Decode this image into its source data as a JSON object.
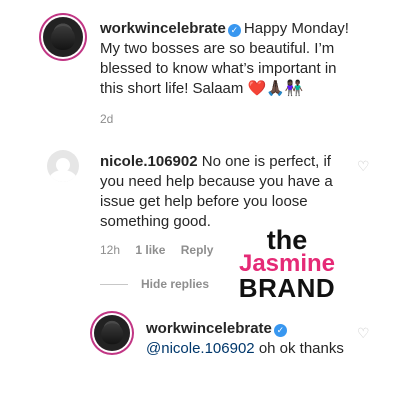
{
  "comments": [
    {
      "username": "workwincelebrate",
      "verified": true,
      "text": "Happy Monday! My two bosses are so beautiful. I’m blessed to know what’s important in this short life! Salaam",
      "emoji": "❤️🙏🏿👫🏿",
      "time": "2d"
    },
    {
      "username": "nicole.106902",
      "verified": false,
      "text": "No one is perfect, if you need help because you have a issue get help before you loose something good.",
      "time": "12h",
      "likes": "1 like",
      "reply": "Reply"
    }
  ],
  "hide_replies": "Hide replies",
  "reply_comment": {
    "username": "workwincelebrate",
    "verified": true,
    "mention": "@nicole.106902",
    "text": "oh ok thanks"
  },
  "watermark": {
    "the": "the",
    "jasmine": "Jasmine",
    "brand": "BRAND"
  },
  "colors": {
    "verified_badge": "#3897f0",
    "mention": "#00376b",
    "meta": "#8e8e8e",
    "watermark_pink": "#e52a76"
  },
  "icons": {
    "like": "heart-outline-icon",
    "verified": "verified-check-icon"
  }
}
